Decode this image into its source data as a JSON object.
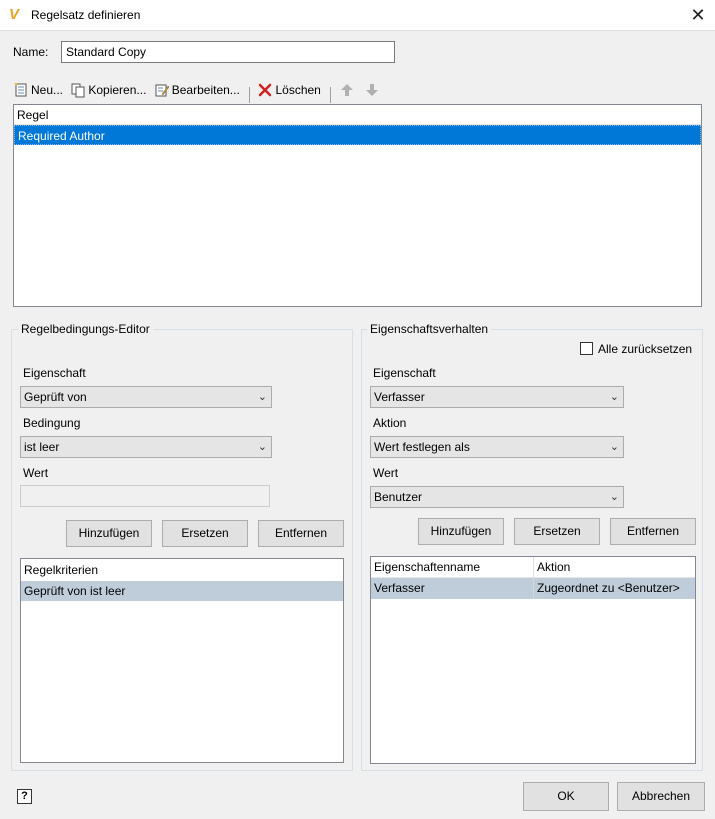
{
  "window": {
    "title": "Regelsatz definieren",
    "app_icon_glyph": "V",
    "close_glyph": "✕"
  },
  "name_field": {
    "label": "Name:",
    "value": "Standard Copy"
  },
  "toolbar": {
    "new_label": "Neu...",
    "copy_label": "Kopieren...",
    "edit_label": "Bearbeiten...",
    "delete_label": "Löschen",
    "move_up_glyph": "🡅",
    "move_down_glyph": "🡇"
  },
  "rules_list": {
    "header": "Regel",
    "rows": [
      "Required Author"
    ],
    "selected_color": "#0078d7"
  },
  "condition_editor": {
    "title": "Regelbedingungs-Editor",
    "property_label": "Eigenschaft",
    "property_value": "Geprüft von",
    "condition_label": "Bedingung",
    "condition_value": "ist leer",
    "value_label": "Wert",
    "value_value": "",
    "add_label": "Hinzufügen",
    "replace_label": "Ersetzen",
    "remove_label": "Entfernen",
    "criteria_header": "Regelkriterien",
    "criteria_rows": [
      "Geprüft von ist leer"
    ]
  },
  "property_behavior": {
    "title": "Eigenschaftsverhalten",
    "reset_all_label": "Alle zurücksetzen",
    "reset_all_checked": false,
    "property_label": "Eigenschaft",
    "property_value": "Verfasser",
    "action_label": "Aktion",
    "action_value": "Wert festlegen als",
    "value_label": "Wert",
    "value_value": "Benutzer",
    "add_label": "Hinzufügen",
    "replace_label": "Ersetzen",
    "remove_label": "Entfernen",
    "grid_columns": [
      "Eigenschaftenname",
      "Aktion"
    ],
    "grid_rows": [
      {
        "name": "Verfasser",
        "action": "Zugeordnet zu <Benutzer>"
      }
    ]
  },
  "footer": {
    "help_glyph": "?",
    "ok_label": "OK",
    "cancel_label": "Abbrechen"
  },
  "colors": {
    "selection_blue": "#0078d7",
    "selection_gray": "#bfcddb",
    "accent_orange": "#e8a41c"
  },
  "icons": {
    "new": "new-document-icon",
    "copy": "copy-icon",
    "edit": "edit-icon",
    "delete": "delete-x-icon",
    "up": "arrow-up-icon",
    "down": "arrow-down-icon",
    "help": "help-icon",
    "close": "close-icon",
    "dropdown": "chevron-down-icon"
  }
}
